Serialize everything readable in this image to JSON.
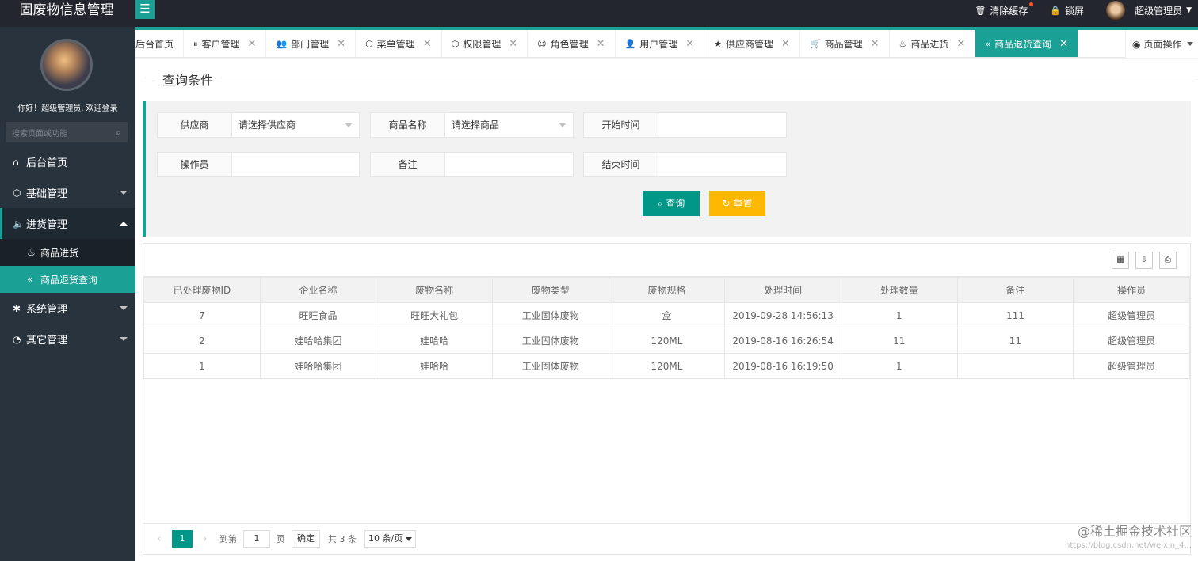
{
  "app": {
    "title": "固废物信息管理"
  },
  "header": {
    "clear_cache": "清除缓存",
    "lock": "锁屏",
    "user": "超级管理员"
  },
  "sidebar": {
    "welcome": "你好！超级管理员, 欢迎登录",
    "search_placeholder": "搜索页面或功能",
    "items": [
      {
        "label": "后台首页"
      },
      {
        "label": "基础管理"
      },
      {
        "label": "进货管理"
      },
      {
        "label": "系统管理"
      },
      {
        "label": "其它管理"
      }
    ],
    "children": [
      {
        "label": "商品进货"
      },
      {
        "label": "商品退货查询"
      }
    ]
  },
  "tabs": [
    {
      "label": "后台首页"
    },
    {
      "label": "客户管理"
    },
    {
      "label": "部门管理"
    },
    {
      "label": "菜单管理"
    },
    {
      "label": "权限管理"
    },
    {
      "label": "角色管理"
    },
    {
      "label": "用户管理"
    },
    {
      "label": "供应商管理"
    },
    {
      "label": "商品管理"
    },
    {
      "label": "商品进货"
    },
    {
      "label": "商品退货查询"
    }
  ],
  "page_op": "页面操作",
  "query": {
    "legend": "查询条件",
    "supplier_label": "供应商",
    "supplier_value": "请选择供应商",
    "goods_label": "商品名称",
    "goods_value": "请选择商品",
    "start_label": "开始时间",
    "operator_label": "操作员",
    "remark_label": "备注",
    "end_label": "结束时间",
    "search_btn": "查询",
    "reset_btn": "重置"
  },
  "table": {
    "columns": [
      "已处理废物ID",
      "企业名称",
      "废物名称",
      "废物类型",
      "废物规格",
      "处理时间",
      "处理数量",
      "备注",
      "操作员"
    ],
    "rows": [
      [
        "7",
        "旺旺食品",
        "旺旺大礼包",
        "工业固体废物",
        "盒",
        "2019-09-28 14:56:13",
        "1",
        "111",
        "超级管理员"
      ],
      [
        "2",
        "娃哈哈集团",
        "娃哈哈",
        "工业固体废物",
        "120ML",
        "2019-08-16 16:26:54",
        "11",
        "11",
        "超级管理员"
      ],
      [
        "1",
        "娃哈哈集团",
        "娃哈哈",
        "工业固体废物",
        "120ML",
        "2019-08-16 16:19:50",
        "1",
        "",
        "超级管理员"
      ]
    ]
  },
  "pager": {
    "current": "1",
    "goto_label": "到第",
    "goto_value": "1",
    "page_unit": "页",
    "confirm": "确定",
    "total": "共 3 条",
    "size": "10 条/页"
  },
  "watermark": {
    "line1": "@稀土掘金技术社区",
    "line2": "https://blog.csdn.net/weixin_4..."
  },
  "colors": {
    "accent": "#1aa094",
    "warn": "#ffb800",
    "sidebar": "#28333e",
    "topbar": "#23262e"
  }
}
